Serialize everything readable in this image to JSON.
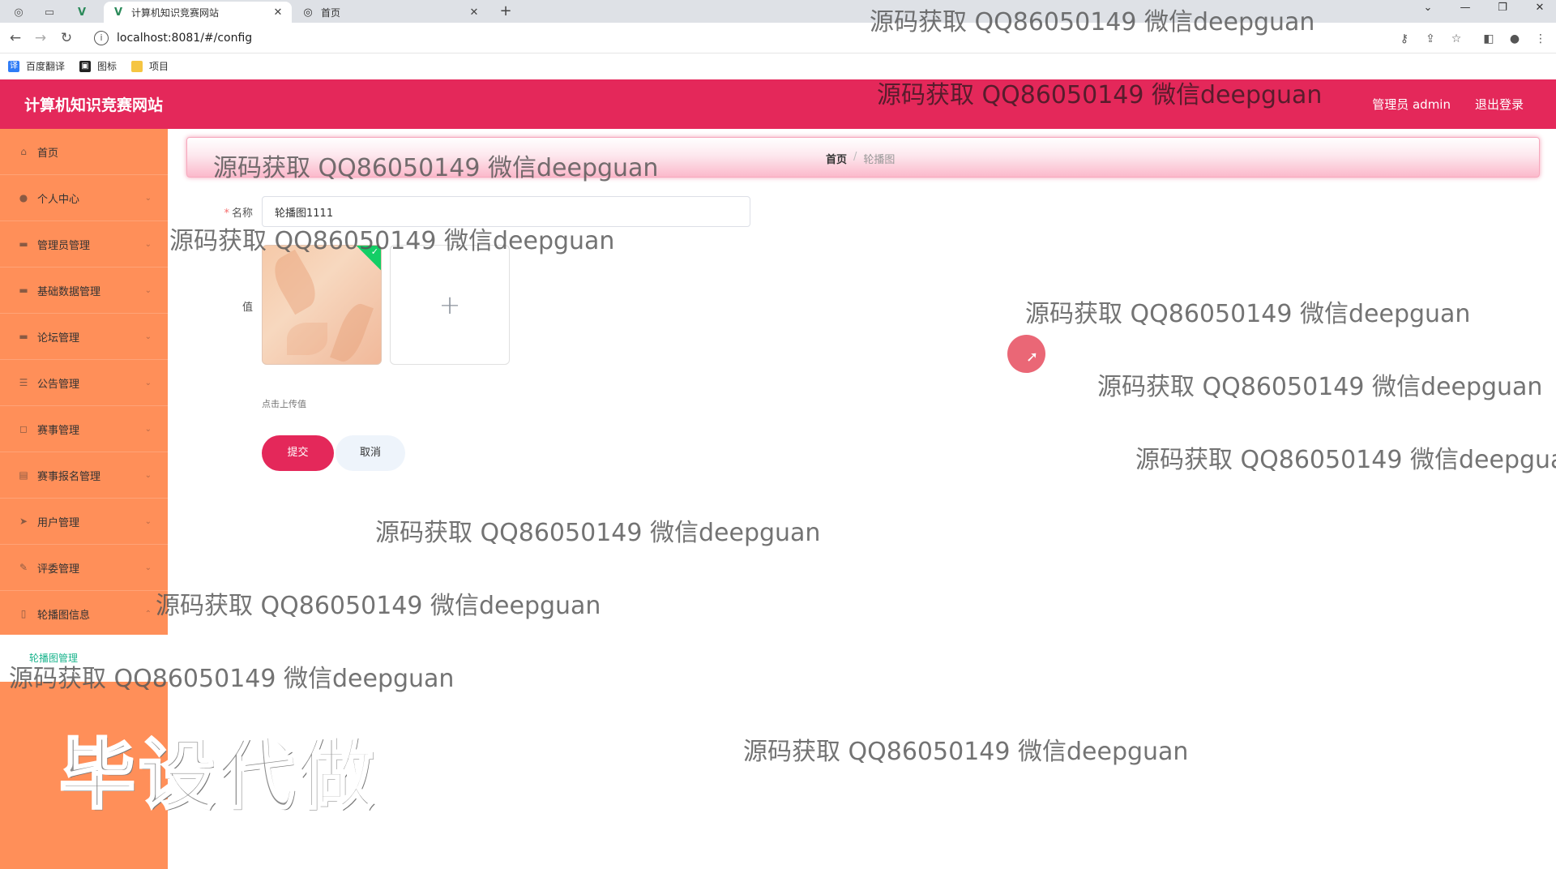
{
  "browser": {
    "tabs": [
      {
        "title": "计算机知识竞赛网站",
        "active": true
      },
      {
        "title": "首页",
        "active": false
      }
    ],
    "url": "localhost:8081/#/config",
    "bookmarks": [
      "百度翻译",
      "图标",
      "项目"
    ]
  },
  "header": {
    "site_title": "计算机知识竞赛网站",
    "admin_label": "管理员 admin",
    "logout_label": "退出登录",
    "accent_color": "#e4285a"
  },
  "sidebar": {
    "bg_color": "#ff8f59",
    "items": [
      {
        "label": "首页",
        "icon": "home-icon"
      },
      {
        "label": "个人中心",
        "icon": "user-icon"
      },
      {
        "label": "管理员管理",
        "icon": "admin-icon"
      },
      {
        "label": "基础数据管理",
        "icon": "data-icon"
      },
      {
        "label": "论坛管理",
        "icon": "forum-icon"
      },
      {
        "label": "公告管理",
        "icon": "notice-icon"
      },
      {
        "label": "赛事管理",
        "icon": "contest-icon"
      },
      {
        "label": "赛事报名管理",
        "icon": "signup-icon"
      },
      {
        "label": "用户管理",
        "icon": "users-icon"
      },
      {
        "label": "评委管理",
        "icon": "judge-icon"
      },
      {
        "label": "轮播图信息",
        "icon": "carousel-icon"
      }
    ],
    "submenu_label": "轮播图管理"
  },
  "breadcrumb": {
    "home": "首页",
    "separator": "/",
    "current": "轮播图"
  },
  "form": {
    "name_label": "名称",
    "name_value": "轮播图1111",
    "value_label": "值",
    "upload_tip": "点击上传值",
    "submit_label": "提交",
    "cancel_label": "取消"
  },
  "watermark": {
    "text": "源码获取 QQ86050149 微信deepguan",
    "big_text": "毕设代做"
  }
}
